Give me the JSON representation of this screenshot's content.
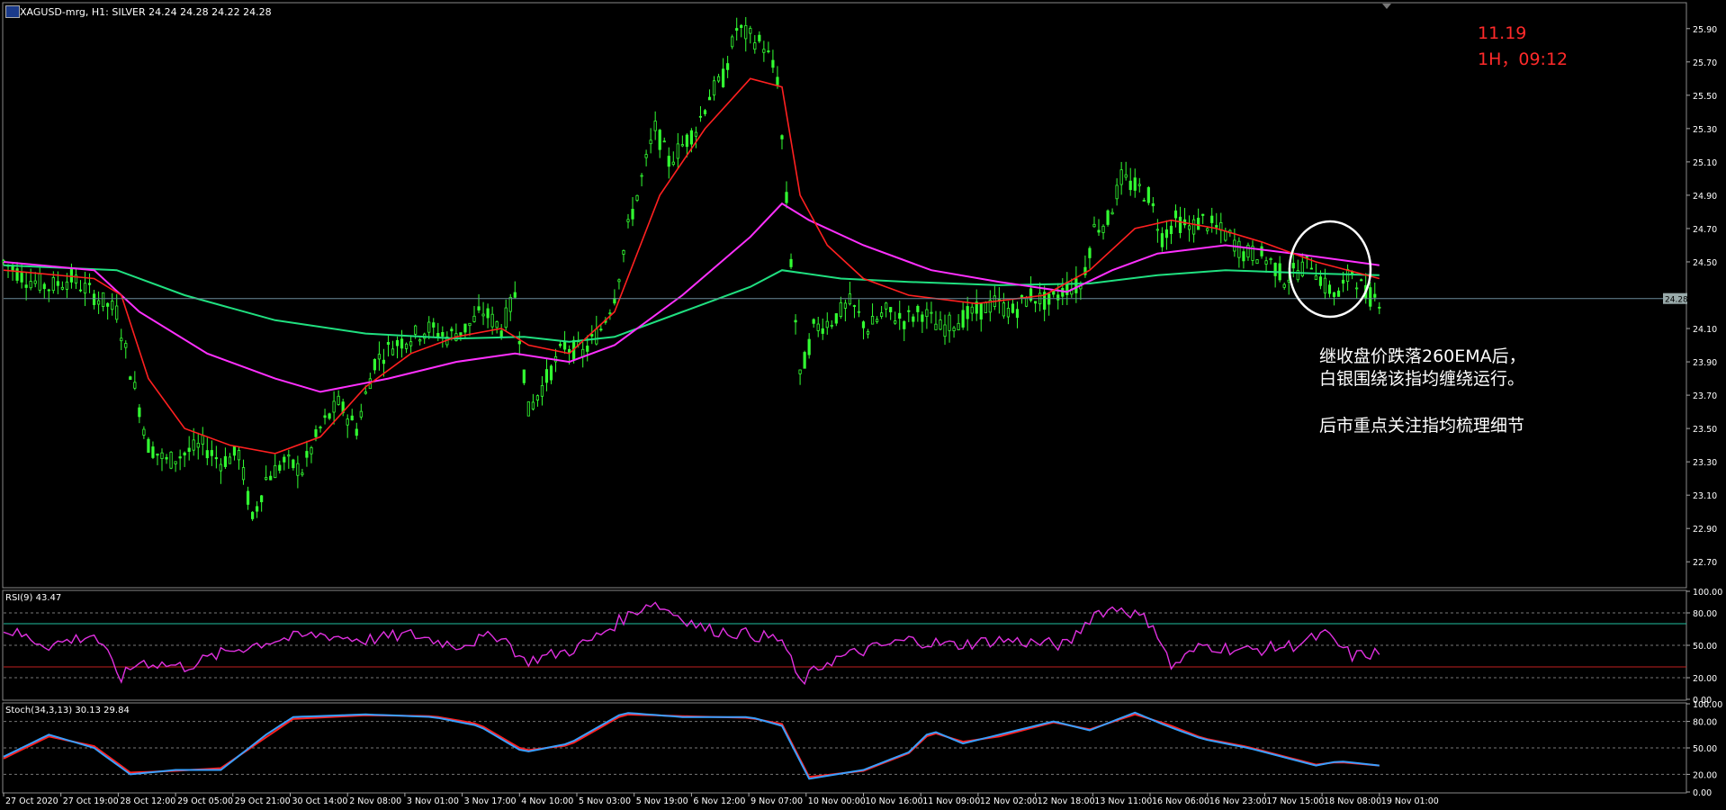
{
  "header": {
    "symbol_text": "XAGUSD-mrg, H1:  SILVER  24.24 24.28 24.22 24.28"
  },
  "annotations": {
    "date": "11.19",
    "time": "1H，09:12",
    "note_line1": "继收盘价跌落260EMA后，",
    "note_line2": "白银围绕该指均缠绕运行。",
    "note_line3": "后市重点关注指均梳理细节"
  },
  "colors": {
    "background": "#000000",
    "candles": "#32ff32",
    "ema_fast": "#ff2020",
    "ema_mid": "#ff30ff",
    "ema_slow": "#20e080",
    "rsi_line": "#e030e0",
    "stoch_main": "#3aa0ff",
    "stoch_signal": "#ff2020",
    "annotation_circle": "#ffffff"
  },
  "chart_data": [
    {
      "type": "line",
      "name_label": "price",
      "title": "XAGUSD-mrg, H1:  SILVER  24.24 24.28 24.22 24.28",
      "y_ticks": [
        "25.90",
        "25.70",
        "25.50",
        "25.30",
        "25.10",
        "24.90",
        "24.70",
        "24.50",
        "24.28",
        "24.10",
        "23.90",
        "23.70",
        "23.50",
        "23.30",
        "23.10",
        "22.90",
        "22.70"
      ],
      "ylim": [
        22.55,
        26.05
      ],
      "current_price": "24.28",
      "x_ticks": [
        "27 Oct 2020",
        "27 Oct 19:00",
        "28 Oct 12:00",
        "29 Oct 05:00",
        "29 Oct 21:00",
        "30 Oct 14:00",
        "2 Nov 08:00",
        "3 Nov 01:00",
        "3 Nov 17:00",
        "4 Nov 10:00",
        "5 Nov 03:00",
        "5 Nov 19:00",
        "6 Nov 12:00",
        "9 Nov 07:00",
        "10 Nov 00:00",
        "10 Nov 16:00",
        "11 Nov 09:00",
        "12 Nov 02:00",
        "12 Nov 18:00",
        "13 Nov 11:00",
        "16 Nov 06:00",
        "16 Nov 23:00",
        "17 Nov 15:00",
        "18 Nov 08:00",
        "19 Nov 01:00"
      ],
      "close_series": [
        [
          0,
          24.5
        ],
        [
          5,
          24.4
        ],
        [
          10,
          24.35
        ],
        [
          15,
          24.4
        ],
        [
          20,
          24.3
        ],
        [
          25,
          24.2
        ],
        [
          28,
          23.85
        ],
        [
          32,
          23.4
        ],
        [
          36,
          23.3
        ],
        [
          40,
          23.35
        ],
        [
          44,
          23.4
        ],
        [
          48,
          23.3
        ],
        [
          52,
          23.35
        ],
        [
          55,
          22.95
        ],
        [
          58,
          23.2
        ],
        [
          62,
          23.3
        ],
        [
          66,
          23.25
        ],
        [
          70,
          23.5
        ],
        [
          74,
          23.65
        ],
        [
          78,
          23.5
        ],
        [
          82,
          23.9
        ],
        [
          86,
          24.0
        ],
        [
          90,
          24.05
        ],
        [
          94,
          24.1
        ],
        [
          98,
          24.05
        ],
        [
          102,
          24.1
        ],
        [
          106,
          24.2
        ],
        [
          110,
          24.1
        ],
        [
          113,
          24.3
        ],
        [
          116,
          23.6
        ],
        [
          120,
          23.8
        ],
        [
          124,
          24.0
        ],
        [
          128,
          23.95
        ],
        [
          132,
          24.1
        ],
        [
          135,
          24.3
        ],
        [
          138,
          24.7
        ],
        [
          141,
          25.0
        ],
        [
          144,
          25.3
        ],
        [
          147,
          25.1
        ],
        [
          150,
          25.2
        ],
        [
          153,
          25.3
        ],
        [
          156,
          25.5
        ],
        [
          159,
          25.6
        ],
        [
          162,
          25.9
        ],
        [
          165,
          25.85
        ],
        [
          168,
          25.8
        ],
        [
          171,
          25.6
        ],
        [
          174,
          24.5
        ],
        [
          176,
          23.8
        ],
        [
          179,
          24.1
        ],
        [
          183,
          24.15
        ],
        [
          187,
          24.25
        ],
        [
          191,
          24.1
        ],
        [
          195,
          24.2
        ],
        [
          199,
          24.15
        ],
        [
          203,
          24.2
        ],
        [
          207,
          24.1
        ],
        [
          211,
          24.15
        ],
        [
          215,
          24.2
        ],
        [
          219,
          24.25
        ],
        [
          223,
          24.2
        ],
        [
          227,
          24.3
        ],
        [
          231,
          24.25
        ],
        [
          235,
          24.35
        ],
        [
          238,
          24.35
        ],
        [
          241,
          24.7
        ],
        [
          244,
          24.75
        ],
        [
          247,
          25.0
        ],
        [
          250,
          24.95
        ],
        [
          253,
          24.9
        ],
        [
          256,
          24.65
        ],
        [
          259,
          24.75
        ],
        [
          262,
          24.7
        ],
        [
          265,
          24.75
        ],
        [
          268,
          24.7
        ],
        [
          271,
          24.65
        ],
        [
          274,
          24.55
        ],
        [
          277,
          24.55
        ],
        [
          280,
          24.5
        ],
        [
          283,
          24.4
        ],
        [
          286,
          24.45
        ],
        [
          289,
          24.5
        ],
        [
          292,
          24.35
        ],
        [
          295,
          24.3
        ],
        [
          298,
          24.45
        ],
        [
          301,
          24.3
        ],
        [
          304,
          24.28
        ]
      ],
      "ema_fast": [
        [
          0,
          24.45
        ],
        [
          20,
          24.4
        ],
        [
          26,
          24.3
        ],
        [
          32,
          23.8
        ],
        [
          40,
          23.5
        ],
        [
          50,
          23.4
        ],
        [
          60,
          23.35
        ],
        [
          70,
          23.45
        ],
        [
          80,
          23.75
        ],
        [
          90,
          23.95
        ],
        [
          100,
          24.05
        ],
        [
          110,
          24.1
        ],
        [
          116,
          24.0
        ],
        [
          125,
          23.95
        ],
        [
          135,
          24.2
        ],
        [
          145,
          24.9
        ],
        [
          155,
          25.3
        ],
        [
          165,
          25.6
        ],
        [
          172,
          25.55
        ],
        [
          176,
          24.9
        ],
        [
          182,
          24.6
        ],
        [
          190,
          24.4
        ],
        [
          200,
          24.3
        ],
        [
          215,
          24.25
        ],
        [
          230,
          24.3
        ],
        [
          240,
          24.45
        ],
        [
          250,
          24.7
        ],
        [
          258,
          24.75
        ],
        [
          268,
          24.7
        ],
        [
          278,
          24.62
        ],
        [
          290,
          24.5
        ],
        [
          304,
          24.4
        ]
      ],
      "ema_mid": [
        [
          0,
          24.5
        ],
        [
          20,
          24.45
        ],
        [
          30,
          24.2
        ],
        [
          45,
          23.95
        ],
        [
          60,
          23.8
        ],
        [
          70,
          23.72
        ],
        [
          85,
          23.8
        ],
        [
          100,
          23.9
        ],
        [
          113,
          23.95
        ],
        [
          125,
          23.9
        ],
        [
          135,
          24.0
        ],
        [
          150,
          24.3
        ],
        [
          165,
          24.65
        ],
        [
          172,
          24.85
        ],
        [
          178,
          24.75
        ],
        [
          190,
          24.6
        ],
        [
          205,
          24.45
        ],
        [
          220,
          24.38
        ],
        [
          235,
          24.32
        ],
        [
          245,
          24.45
        ],
        [
          255,
          24.55
        ],
        [
          270,
          24.6
        ],
        [
          285,
          24.55
        ],
        [
          304,
          24.48
        ]
      ],
      "ema_slow": [
        [
          0,
          24.48
        ],
        [
          25,
          24.45
        ],
        [
          40,
          24.3
        ],
        [
          60,
          24.15
        ],
        [
          80,
          24.07
        ],
        [
          100,
          24.04
        ],
        [
          115,
          24.05
        ],
        [
          125,
          24.02
        ],
        [
          135,
          24.05
        ],
        [
          150,
          24.2
        ],
        [
          165,
          24.35
        ],
        [
          172,
          24.45
        ],
        [
          185,
          24.4
        ],
        [
          200,
          24.38
        ],
        [
          220,
          24.36
        ],
        [
          240,
          24.37
        ],
        [
          255,
          24.42
        ],
        [
          270,
          24.45
        ],
        [
          290,
          24.43
        ],
        [
          304,
          24.42
        ]
      ]
    },
    {
      "type": "line",
      "name_label": "RSI",
      "title": "RSI(9) 43.47",
      "y_ticks": [
        "100.00",
        "80.00",
        "50.00",
        "20.00",
        "0.00"
      ],
      "ylim": [
        0,
        100
      ],
      "levels": [
        70,
        30
      ],
      "values": [
        [
          0,
          65
        ],
        [
          10,
          50
        ],
        [
          20,
          60
        ],
        [
          26,
          20
        ],
        [
          30,
          35
        ],
        [
          40,
          30
        ],
        [
          50,
          45
        ],
        [
          60,
          55
        ],
        [
          70,
          60
        ],
        [
          80,
          55
        ],
        [
          90,
          60
        ],
        [
          100,
          50
        ],
        [
          110,
          60
        ],
        [
          115,
          35
        ],
        [
          125,
          45
        ],
        [
          130,
          55
        ],
        [
          137,
          75
        ],
        [
          143,
          90
        ],
        [
          148,
          80
        ],
        [
          155,
          65
        ],
        [
          165,
          60
        ],
        [
          172,
          55
        ],
        [
          176,
          15
        ],
        [
          182,
          35
        ],
        [
          190,
          45
        ],
        [
          200,
          55
        ],
        [
          210,
          50
        ],
        [
          220,
          55
        ],
        [
          235,
          50
        ],
        [
          241,
          80
        ],
        [
          247,
          85
        ],
        [
          254,
          70
        ],
        [
          258,
          30
        ],
        [
          265,
          50
        ],
        [
          275,
          45
        ],
        [
          285,
          50
        ],
        [
          292,
          60
        ],
        [
          298,
          40
        ],
        [
          304,
          43
        ]
      ]
    },
    {
      "type": "line",
      "name_label": "Stochastic",
      "title": "Stoch(34,3,13) 30.13 29.84",
      "y_ticks": [
        "100.00",
        "80.00",
        "50.00",
        "20.00",
        "0.00"
      ],
      "ylim": [
        0,
        100
      ],
      "levels": [
        80,
        20
      ],
      "main": [
        [
          0,
          40
        ],
        [
          10,
          65
        ],
        [
          20,
          50
        ],
        [
          28,
          20
        ],
        [
          38,
          25
        ],
        [
          48,
          25
        ],
        [
          58,
          65
        ],
        [
          64,
          85
        ],
        [
          80,
          88
        ],
        [
          95,
          85
        ],
        [
          105,
          75
        ],
        [
          115,
          45
        ],
        [
          125,
          55
        ],
        [
          137,
          90
        ],
        [
          150,
          85
        ],
        [
          165,
          85
        ],
        [
          172,
          75
        ],
        [
          178,
          15
        ],
        [
          190,
          25
        ],
        [
          200,
          45
        ],
        [
          205,
          70
        ],
        [
          212,
          55
        ],
        [
          220,
          65
        ],
        [
          232,
          80
        ],
        [
          240,
          70
        ],
        [
          250,
          90
        ],
        [
          257,
          75
        ],
        [
          265,
          60
        ],
        [
          275,
          50
        ],
        [
          290,
          30
        ],
        [
          295,
          35
        ],
        [
          304,
          30
        ]
      ],
      "signal": [
        [
          0,
          38
        ],
        [
          10,
          63
        ],
        [
          20,
          52
        ],
        [
          28,
          22
        ],
        [
          38,
          24
        ],
        [
          48,
          27
        ],
        [
          58,
          62
        ],
        [
          64,
          83
        ],
        [
          80,
          87
        ],
        [
          95,
          86
        ],
        [
          105,
          77
        ],
        [
          115,
          47
        ],
        [
          125,
          53
        ],
        [
          137,
          88
        ],
        [
          150,
          86
        ],
        [
          165,
          84
        ],
        [
          172,
          77
        ],
        [
          178,
          17
        ],
        [
          190,
          24
        ],
        [
          200,
          44
        ],
        [
          205,
          68
        ],
        [
          212,
          57
        ],
        [
          220,
          63
        ],
        [
          232,
          79
        ],
        [
          240,
          71
        ],
        [
          250,
          88
        ],
        [
          257,
          77
        ],
        [
          265,
          61
        ],
        [
          275,
          51
        ],
        [
          290,
          31
        ],
        [
          295,
          34
        ],
        [
          304,
          30
        ]
      ]
    }
  ]
}
